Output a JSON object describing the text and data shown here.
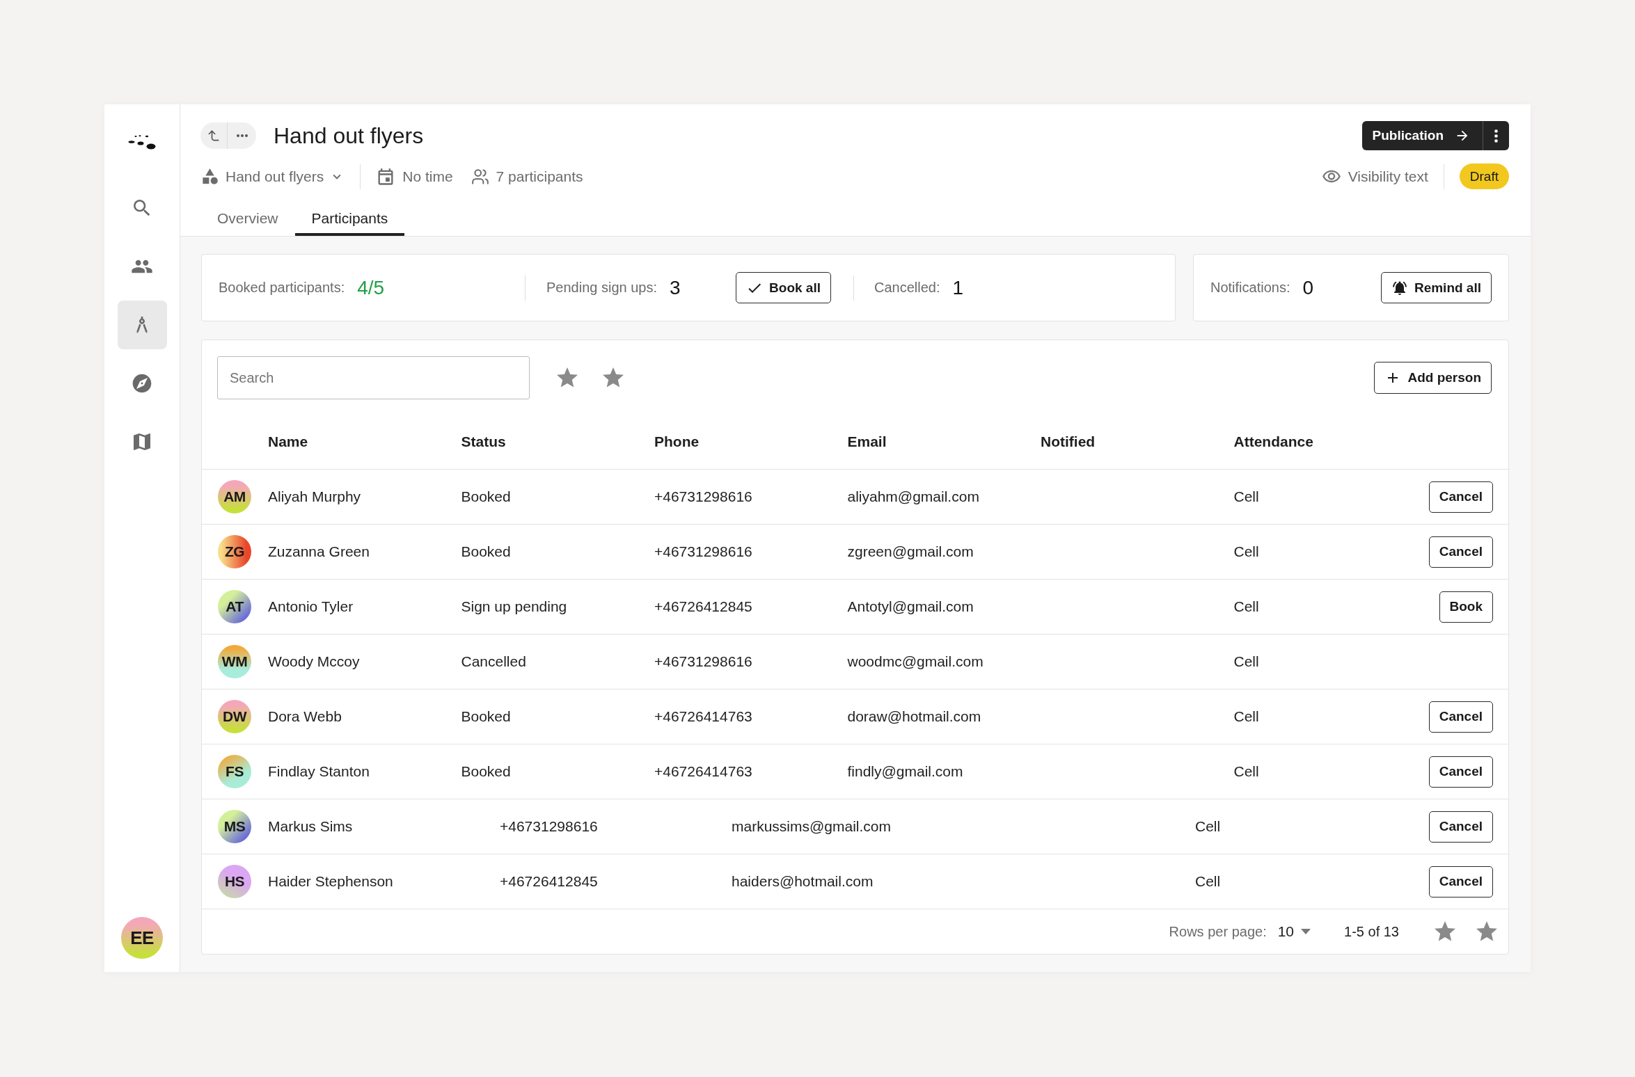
{
  "sidebar": {
    "items": [
      {
        "kind": "search",
        "selected": false
      },
      {
        "kind": "people",
        "selected": false
      },
      {
        "kind": "drafting",
        "selected": true
      },
      {
        "kind": "explore",
        "selected": false
      },
      {
        "kind": "map",
        "selected": false
      }
    ],
    "user": {
      "initials": "EE"
    }
  },
  "header": {
    "title": "Hand out flyers",
    "project": "Hand out flyers",
    "time": "No time",
    "participants": "7 participants",
    "visibility": "Visibility text",
    "status": "Draft",
    "publish_button": "Publication"
  },
  "tabs": [
    {
      "label": "Overview",
      "selected": false
    },
    {
      "label": "Participants",
      "selected": true
    }
  ],
  "summary": {
    "booked": {
      "label": "Booked participants:",
      "value": "4/5"
    },
    "pending": {
      "label": "Pending sign ups:",
      "value": "3"
    },
    "book_all_button": "Book all",
    "cancelled": {
      "label": "Cancelled:",
      "value": "1"
    }
  },
  "notifications": {
    "label": "Notifications:",
    "value": "0",
    "button": "Remind all"
  },
  "table": {
    "search": {
      "placeholder": "Search"
    },
    "add_button": "Add person",
    "columns": [
      "Name",
      "Status",
      "Phone",
      "Email",
      "Notified",
      "Attendance"
    ],
    "rows": [
      {
        "initials": "AM",
        "name": "Aliyah Murphy",
        "status": "Booked",
        "phone": "+46731298616",
        "email": "aliyahm@gmail.com",
        "attendance": "Cell",
        "action": "Cancel"
      },
      {
        "initials": "ZG",
        "name": "Zuzanna Green",
        "status": "Booked",
        "phone": "+46731298616",
        "email": "zgreen@gmail.com",
        "attendance": "Cell",
        "action": "Cancel"
      },
      {
        "initials": "AT",
        "name": "Antonio Tyler",
        "status": "Sign up pending",
        "phone": "+46726412845",
        "email": "Antotyl@gmail.com",
        "attendance": "Cell",
        "action": "Book"
      },
      {
        "initials": "WM",
        "name": "Woody Mccoy",
        "status": "Cancelled",
        "phone": "+46731298616",
        "email": "woodmc@gmail.com",
        "attendance": "Cell"
      },
      {
        "initials": "DW",
        "name": "Dora Webb",
        "status": "Booked",
        "phone": "+46726414763",
        "email": "doraw@hotmail.com",
        "attendance": "Cell",
        "action": "Cancel"
      },
      {
        "initials": "FS",
        "name": "Findlay Stanton",
        "status": "Booked",
        "phone": "+46726414763",
        "email": "findly@gmail.com",
        "attendance": "Cell",
        "action": "Cancel"
      },
      {
        "initials": "MS",
        "name": "Markus Sims",
        "phone": "+46731298616",
        "email": "markussims@gmail.com",
        "attendance": "Cell",
        "action": "Cancel"
      },
      {
        "initials": "HS",
        "name": "Haider Stephenson",
        "phone": "+46726412845",
        "email": "haiders@hotmail.com",
        "attendance": "Cell",
        "action": "Cancel"
      }
    ],
    "footer": {
      "rows_per_page_label": "Rows per page:",
      "rows_per_page": "10",
      "range": "1-5 of 13"
    }
  }
}
